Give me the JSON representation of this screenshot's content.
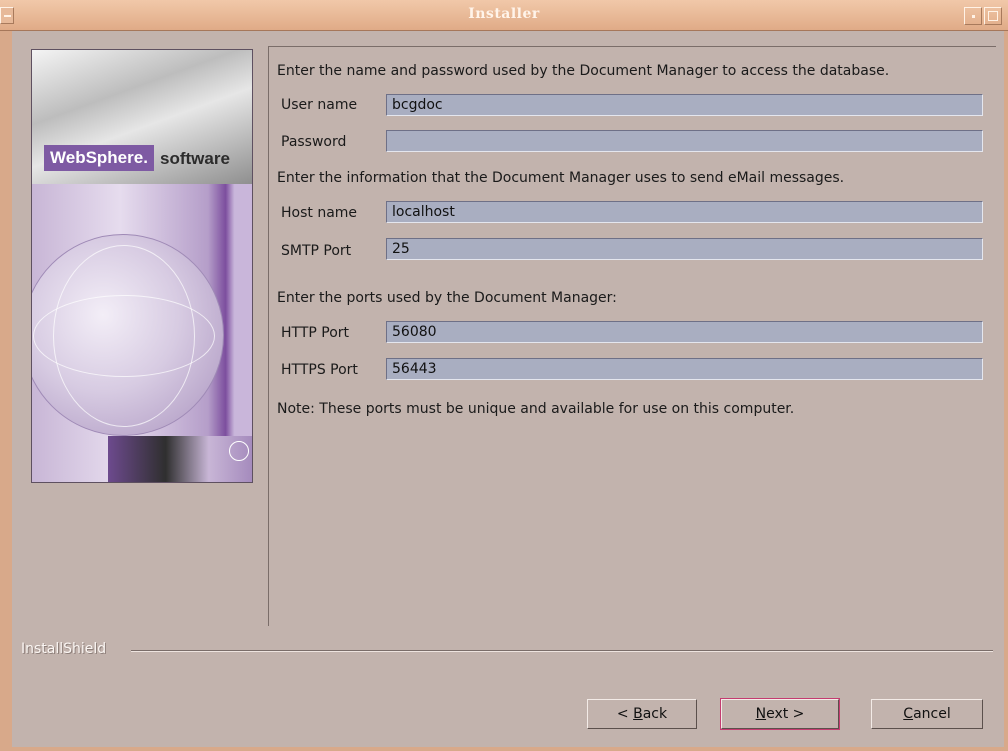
{
  "window": {
    "title": "Installer"
  },
  "branding": {
    "logo_text": "WebSphere.",
    "logo_suffix": "software"
  },
  "form": {
    "db_intro": "Enter the name and password used by the Document Manager to access the database.",
    "user_name_label": "User name",
    "user_name_value": "bcgdoc",
    "password_label": "Password",
    "password_value": "",
    "email_intro": "Enter the information that the Document Manager uses to send eMail messages.",
    "host_name_label": "Host name",
    "host_name_value": "localhost",
    "smtp_port_label": "SMTP Port",
    "smtp_port_value": "25",
    "ports_intro": "Enter the ports used by the Document Manager:",
    "http_port_label": "HTTP Port",
    "http_port_value": "56080",
    "https_port_label": "HTTPS Port",
    "https_port_value": "56443",
    "note": "Note: These ports must be unique and available for use on this computer."
  },
  "footer": {
    "installshield_label": "InstallShield"
  },
  "buttons": {
    "back_prefix": "< ",
    "back_mnemonic": "B",
    "back_rest": "ack",
    "next_mnemonic": "N",
    "next_rest": "ext >",
    "cancel_mnemonic": "C",
    "cancel_rest": "ancel"
  },
  "colors": {
    "title_bar": "#e0ab87",
    "window_bg": "#c2b3ad",
    "field_bg": "#a9aec1",
    "default_button_outline": "#c43c70"
  }
}
